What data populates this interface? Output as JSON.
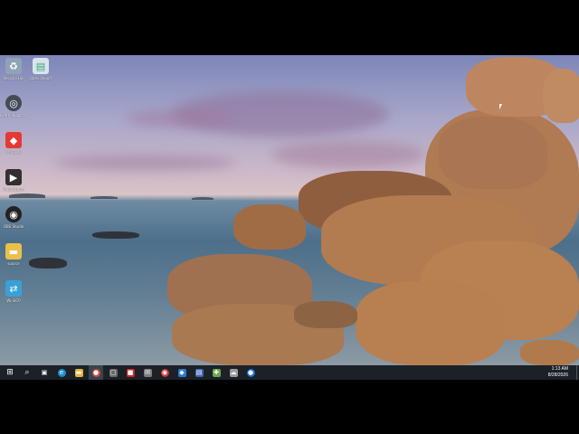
{
  "desktop": {
    "icons": [
      {
        "label": "Recycle Bin",
        "icon": "recycle-bin-icon",
        "color": "#8fa3b5"
      },
      {
        "label": "Sales Report",
        "icon": "document-icon",
        "color": "#d9e4ec"
      },
      {
        "label": "Learn about this picture",
        "icon": "camera-icon",
        "color": "#444b55"
      },
      {
        "label": "AnyDesk",
        "icon": "anydesk-icon",
        "color": "#e53935"
      },
      {
        "label": "MobaXterm",
        "icon": "terminal-icon",
        "color": "#303030"
      },
      {
        "label": "OBS Studio",
        "icon": "obs-icon",
        "color": "#222"
      },
      {
        "label": "source",
        "icon": "folder-icon",
        "color": "#e8c04a"
      },
      {
        "label": "WinSCP",
        "icon": "winscp-icon",
        "color": "#3aa0d8"
      }
    ]
  },
  "taskbar": {
    "items": [
      {
        "name": "start-button",
        "icon": "windows-icon",
        "glyph": "⊞",
        "color": "#1c2127"
      },
      {
        "name": "search-button",
        "icon": "search-icon",
        "glyph": "⌕",
        "color": "#1c2127"
      },
      {
        "name": "task-view-button",
        "icon": "task-view-icon",
        "glyph": "▣",
        "color": "#1c2127"
      },
      {
        "name": "edge-button",
        "icon": "edge-icon",
        "glyph": "e",
        "color": "#1f8ad2"
      },
      {
        "name": "file-explorer-button",
        "icon": "folder-icon",
        "glyph": "▬",
        "color": "#e8b53a"
      },
      {
        "name": "chrome-button",
        "icon": "chrome-icon",
        "glyph": "●",
        "color": "#d94a38"
      },
      {
        "name": "app-button-1",
        "icon": "window-icon",
        "glyph": "▢",
        "color": "#6a6a6a"
      },
      {
        "name": "app-button-2",
        "icon": "video-icon",
        "glyph": "■",
        "color": "#c62828"
      },
      {
        "name": "mail-button",
        "icon": "mail-icon",
        "glyph": "✉",
        "color": "#7d7d7d"
      },
      {
        "name": "obs-button",
        "icon": "obs-icon",
        "glyph": "◉",
        "color": "#cc3333"
      },
      {
        "name": "vscode-button",
        "icon": "vscode-icon",
        "glyph": "◆",
        "color": "#2e7ad1"
      },
      {
        "name": "app-button-3",
        "icon": "document-icon",
        "glyph": "▤",
        "color": "#3f63b5"
      },
      {
        "name": "app-button-4",
        "icon": "tool-icon",
        "glyph": "✚",
        "color": "#6aa84f"
      },
      {
        "name": "app-button-5",
        "icon": "cloud-icon",
        "glyph": "☁",
        "color": "#9e9e9e"
      },
      {
        "name": "app-button-6",
        "icon": "chat-icon",
        "glyph": "●",
        "color": "#1e6fd9"
      }
    ],
    "time": "1:13 AM",
    "date": "8/28/2026"
  }
}
